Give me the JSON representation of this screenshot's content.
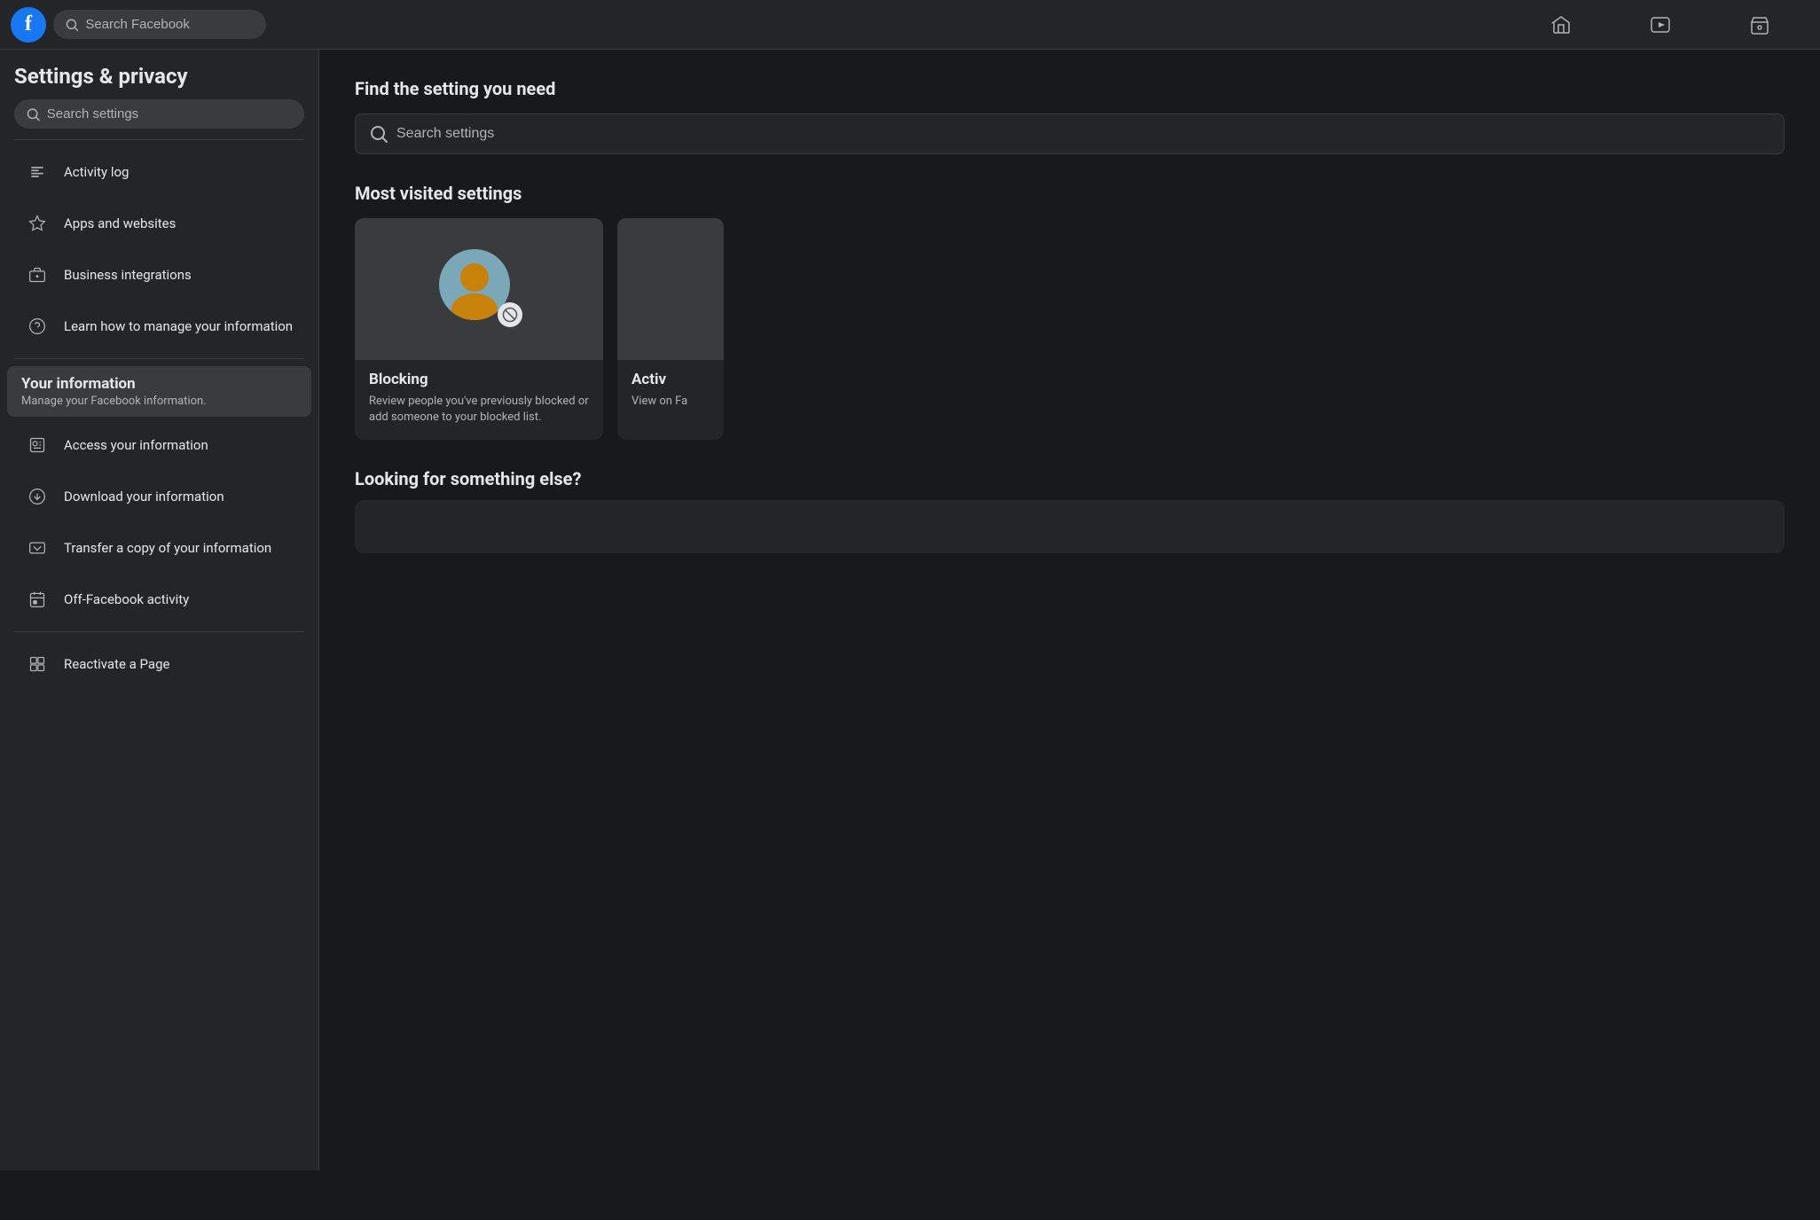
{
  "topnav": {
    "logo": "f",
    "search_placeholder": "Search Facebook",
    "nav_icons": [
      {
        "name": "home-icon",
        "symbol": "⌂"
      },
      {
        "name": "watch-icon",
        "symbol": "▶"
      },
      {
        "name": "marketplace-icon",
        "symbol": "🏪"
      }
    ]
  },
  "sidebar": {
    "title": "Settings & privacy",
    "search_placeholder": "Search settings",
    "items": [
      {
        "name": "activity-log",
        "label": "Activity log",
        "icon": "≡"
      },
      {
        "name": "apps-websites",
        "label": "Apps and websites",
        "icon": "⬡"
      },
      {
        "name": "business-integrations",
        "label": "Business integrations",
        "icon": "💼"
      },
      {
        "name": "learn-manage",
        "label": "Learn how to manage your information",
        "icon": "?"
      }
    ],
    "your_information": {
      "title": "Your information",
      "subtitle": "Manage your Facebook information."
    },
    "sub_items": [
      {
        "name": "access-info",
        "label": "Access your information",
        "icon": "👤"
      },
      {
        "name": "download-info",
        "label": "Download your information",
        "icon": "⬇"
      },
      {
        "name": "transfer-info",
        "label": "Transfer a copy of your information",
        "icon": "⇄"
      },
      {
        "name": "off-facebook",
        "label": "Off-Facebook activity",
        "icon": "📅"
      },
      {
        "name": "reactivate-page",
        "label": "Reactivate a Page",
        "icon": "▦"
      }
    ]
  },
  "main": {
    "find_title": "Find the setting you need",
    "search_placeholder": "Search settings",
    "most_visited_title": "Most visited settings",
    "blocking_card": {
      "title": "Blocking",
      "description": "Review people you've previously blocked or add someone to your blocked list."
    },
    "activity_card": {
      "title": "Activ",
      "description": "View on Fa"
    },
    "looking_title": "Looking for something else?"
  }
}
